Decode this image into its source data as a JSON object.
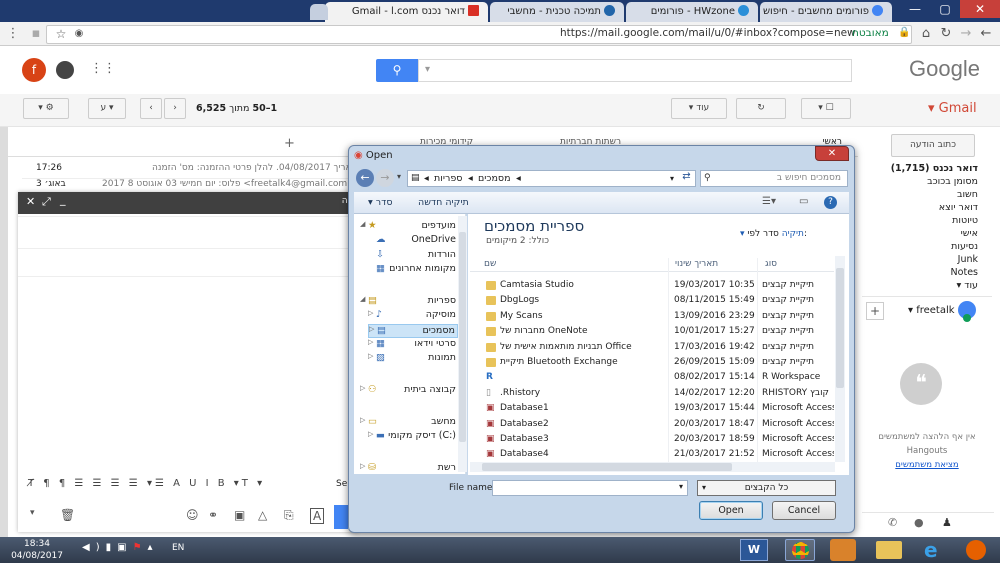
{
  "browser": {
    "tabs": [
      {
        "label": "פורומים מחשבים - חיפוש",
        "favicon_color": "#4285f4"
      },
      {
        "label": "HWzone - פורומים",
        "favicon_color": "#2a8fd8"
      },
      {
        "label": "תמיכה טכנית - מחשבי",
        "favicon_color": "#2266aa"
      },
      {
        "label": "דואר נכנס Gmail - l.com",
        "favicon_color": "#d93025",
        "active": true
      }
    ],
    "url": "https://mail.google.com/mail/u/0/#inbox?compose=new",
    "security_label": "מאובטח"
  },
  "gmail": {
    "logo": "Google",
    "avatar_letter": "f",
    "brand": "Gmail",
    "more_button": "עוד",
    "pagination": {
      "range": "1–50",
      "of_label": "מתוך",
      "total": "6,525"
    },
    "language_button": "ע",
    "compose_button": "כתוב הודעה",
    "nav": [
      {
        "label": "דואר נכנס (1,715)",
        "bold": true
      },
      {
        "label": "מסומן בכוכב"
      },
      {
        "label": "חשוב"
      },
      {
        "label": "דואר יוצא"
      },
      {
        "label": "טיוטות"
      },
      {
        "label": "אישי"
      },
      {
        "label": "נסיעות"
      },
      {
        "label": "Junk"
      },
      {
        "label": "Notes"
      },
      {
        "label": "עוד ▾"
      }
    ],
    "hangouts": {
      "user": "freetalk",
      "message": "אין אף הלהצה למשתמשים",
      "service": "Hangouts",
      "find_link": "מציאת משתמשים"
    },
    "category_tabs": [
      "ראשי",
      "רשתות חברתיות",
      "קידומי מכירות"
    ],
    "email_rows": [
      {
        "time": "17:26",
        "snippet": "ולא בשווה\" בתאריך 04/08/2017. להלן פרטי ההזמנה: מס' הזמנה"
      },
      {
        "time": "3 באוג׳",
        "snippet": "freetalk4@gmail.com> פלוס: יום חמישי 03 אוגוסט 8 2017"
      }
    ],
    "compose": {
      "header_text": "שה",
      "send_label": "Se"
    }
  },
  "dialog": {
    "title": "Open",
    "breadcrumb": [
      "ספריות",
      "מסמכים"
    ],
    "search_placeholder": "מסמכים חיפוש ב",
    "organize": "סדר",
    "new_folder": "תיקיה חדשה",
    "library_title": "ספריית מסמכים",
    "library_subtitle": "כולל: 2 מיקומים",
    "arrange_label": "סדר לפי:",
    "arrange_value": "תיקיה",
    "columns": {
      "name": "שם",
      "date": "תאריך שינוי",
      "type": "סוג"
    },
    "nav": [
      {
        "label": "מועדפים",
        "level": 0
      },
      {
        "label": "OneDrive",
        "level": 1
      },
      {
        "label": "הורדות",
        "level": 1
      },
      {
        "label": "מקומות אחרונים",
        "level": 1
      },
      {
        "label": "ספריות",
        "level": 0
      },
      {
        "label": "מוסיקה",
        "level": 1
      },
      {
        "label": "מסמכים",
        "level": 1,
        "selected": true
      },
      {
        "label": "סרטי וידאו",
        "level": 1
      },
      {
        "label": "תמונות",
        "level": 1
      },
      {
        "label": "קבוצה ביתית",
        "level": 0
      },
      {
        "label": "מחשב",
        "level": 0
      },
      {
        "label": "דיסק מקומי (C:)",
        "level": 1
      },
      {
        "label": "רשת",
        "level": 0
      }
    ],
    "files": [
      {
        "name": "Camtasia Studio",
        "date": "19/03/2017 10:35",
        "type": "תיקיית קבצים",
        "icon": "folder"
      },
      {
        "name": "DbgLogs",
        "date": "08/11/2015 15:49",
        "type": "תיקיית קבצים",
        "icon": "folder"
      },
      {
        "name": "My Scans",
        "date": "13/09/2016 23:29",
        "type": "תיקיית קבצים",
        "icon": "folder"
      },
      {
        "name": "מחברות של OneNote",
        "date": "10/01/2017 15:27",
        "type": "תיקיית קבצים",
        "icon": "folder"
      },
      {
        "name": "תבניות מותאמות אישית של Office",
        "date": "17/03/2016 19:42",
        "type": "תיקיית קבצים",
        "icon": "folder"
      },
      {
        "name": "תיקיית Bluetooth Exchange",
        "date": "26/09/2015 15:09",
        "type": "תיקיית קבצים",
        "icon": "folder"
      },
      {
        "name": "",
        "date": "08/02/2017 15:14",
        "type": "R Workspace",
        "icon": "r"
      },
      {
        "name": ".Rhistory",
        "date": "14/02/2017 12:20",
        "type": "RHISTORY קובץ",
        "icon": "file"
      },
      {
        "name": "Database1",
        "date": "19/03/2017 15:44",
        "type": "Microsoft Access ...",
        "icon": "access"
      },
      {
        "name": "Database2",
        "date": "20/03/2017 18:47",
        "type": "Microsoft Access ...",
        "icon": "access"
      },
      {
        "name": "Database3",
        "date": "20/03/2017 18:59",
        "type": "Microsoft Access ...",
        "icon": "access"
      },
      {
        "name": "Database4",
        "date": "21/03/2017 21:52",
        "type": "Microsoft Access ...",
        "icon": "access"
      }
    ],
    "file_name_label": "File name:",
    "file_type": "כל הקבצים",
    "open_button": "Open",
    "cancel_button": "Cancel"
  },
  "taskbar": {
    "time": "18:34",
    "date": "04/08/2017",
    "language": "EN"
  }
}
